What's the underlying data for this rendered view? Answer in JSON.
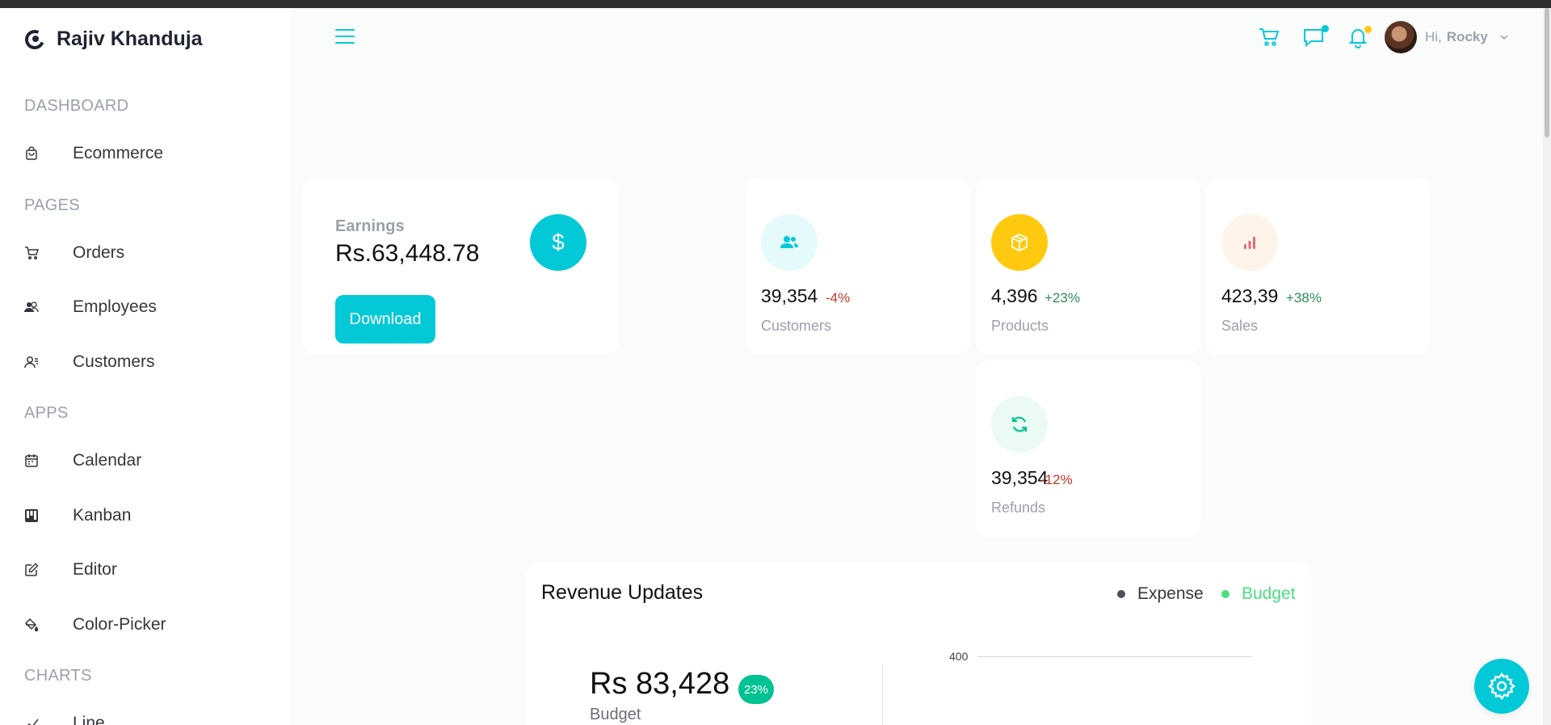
{
  "brand": {
    "name": "Rajiv Khanduja"
  },
  "sidebar": {
    "sections": [
      {
        "title": "DASHBOARD",
        "items": [
          {
            "label": "Ecommerce",
            "icon": "shopping-bag-icon"
          }
        ]
      },
      {
        "title": "PAGES",
        "items": [
          {
            "label": "Orders",
            "icon": "cart-icon"
          },
          {
            "label": "Employees",
            "icon": "employees-icon"
          },
          {
            "label": "Customers",
            "icon": "customers-icon"
          }
        ]
      },
      {
        "title": "APPS",
        "items": [
          {
            "label": "Calendar",
            "icon": "calendar-icon"
          },
          {
            "label": "Kanban",
            "icon": "kanban-icon"
          },
          {
            "label": "Editor",
            "icon": "edit-icon"
          },
          {
            "label": "Color-Picker",
            "icon": "color-picker-icon"
          }
        ]
      },
      {
        "title": "CHARTS",
        "items": [
          {
            "label": "Line",
            "icon": "line-chart-icon"
          }
        ]
      }
    ]
  },
  "header": {
    "greeting": "Hi,",
    "user_name": "Rocky",
    "icons": [
      "menu-icon",
      "cart-icon",
      "chat-icon",
      "bell-icon",
      "chevron-down-icon"
    ],
    "colors": {
      "accent": "#03c9d7",
      "chat_dot": "#03c9d7",
      "bell_dot": "#fec90f"
    }
  },
  "earnings": {
    "label": "Earnings",
    "value": "Rs.63,448.78",
    "icon": "dollar-icon",
    "button_label": "Download"
  },
  "stats": [
    {
      "amount": "39,354",
      "percentage": "-4%",
      "title": "Customers",
      "pct_color": "#c0392b",
      "icon": "customers-icon",
      "icon_color": "#03c9d7",
      "icon_bg": "#e5fafb"
    },
    {
      "amount": "4,396",
      "percentage": "+23%",
      "title": "Products",
      "pct_color": "#2e8b57",
      "icon": "box-icon",
      "icon_color": "#ffffff",
      "icon_bg": "#fec90f"
    },
    {
      "amount": "423,39",
      "percentage": "+38%",
      "title": "Sales",
      "pct_color": "#2e8b57",
      "icon": "bar-chart-icon",
      "icon_color": "#e46a76",
      "icon_bg": "#fff4ea"
    },
    {
      "amount": "39,354",
      "percentage": "-12%",
      "title": "Refunds",
      "pct_color": "#c0392b",
      "icon": "refresh-icon",
      "icon_color": "#00c292",
      "icon_bg": "#ebfaf2"
    }
  ],
  "revenue": {
    "title": "Revenue Updates",
    "legend": [
      {
        "label": "Expense",
        "color": "#33373e"
      },
      {
        "label": "Budget",
        "color": "#4ade80"
      }
    ],
    "budget_value": "Rs 83,428",
    "budget_badge": "23%",
    "budget_label": "Budget",
    "axis_tick": "400"
  },
  "settings": {
    "icon": "gear-icon"
  }
}
